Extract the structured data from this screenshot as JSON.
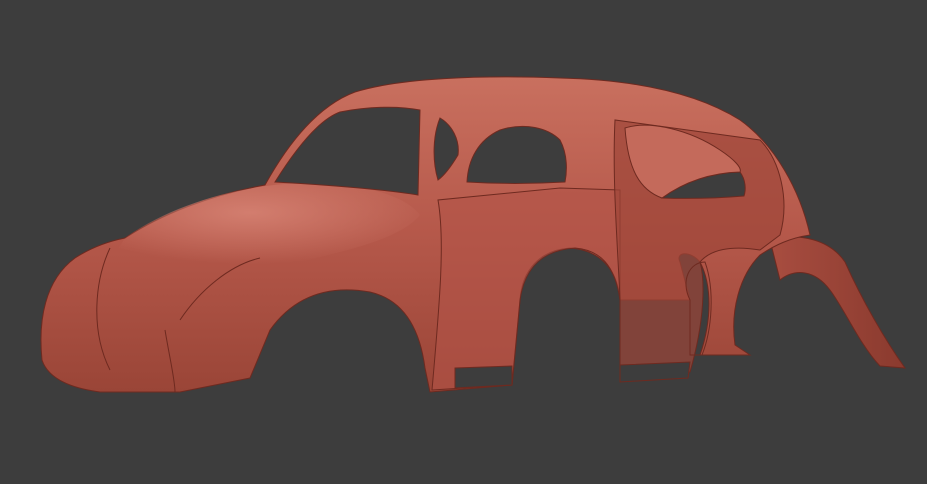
{
  "scene": {
    "colors": {
      "background": "#3d3d3d",
      "body_base": "#b5584a",
      "body_highlight": "#d98677",
      "body_shadow": "#8a3a2e",
      "edge_line": "#6e2a20"
    }
  }
}
